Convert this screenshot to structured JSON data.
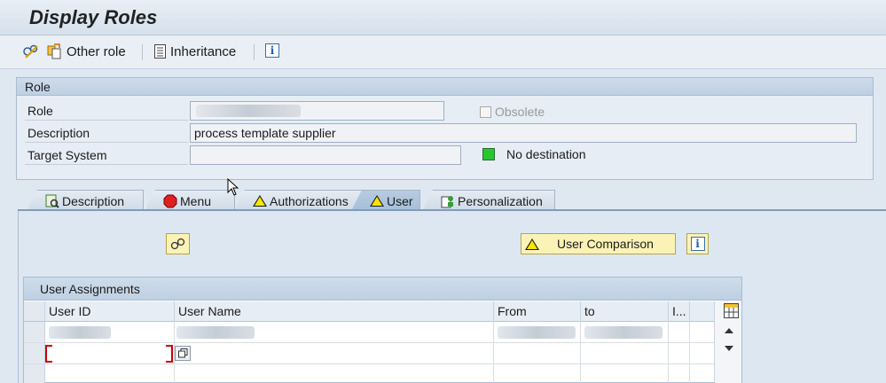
{
  "title": "Display Roles",
  "toolbar": {
    "other_role_label": "Other role",
    "inheritance_label": "Inheritance",
    "info_label": "i"
  },
  "role_group": {
    "header": "Role",
    "role_label": "Role",
    "obsolete_label": "Obsolete",
    "description_label": "Description",
    "description_value": "process template supplier",
    "target_system_label": "Target System",
    "no_destination_label": "No destination"
  },
  "tabs": [
    {
      "label": "Description",
      "icon": "description-icon"
    },
    {
      "label": "Menu",
      "icon": "red-status-icon"
    },
    {
      "label": "Authorizations",
      "icon": "warning-icon"
    },
    {
      "label": "User",
      "icon": "warning-icon",
      "active": true
    },
    {
      "label": "Personalization",
      "icon": "personalization-icon"
    }
  ],
  "user_tab": {
    "user_comparison_label": "User Comparison"
  },
  "user_assignments": {
    "title": "User Assignments",
    "columns": [
      "User ID",
      "User Name",
      "From",
      "to",
      "I..."
    ]
  },
  "colors": {
    "warning": "#ffe600",
    "status_green": "#28c72e",
    "status_red": "#e02020",
    "accent": "#1f5fa6"
  }
}
